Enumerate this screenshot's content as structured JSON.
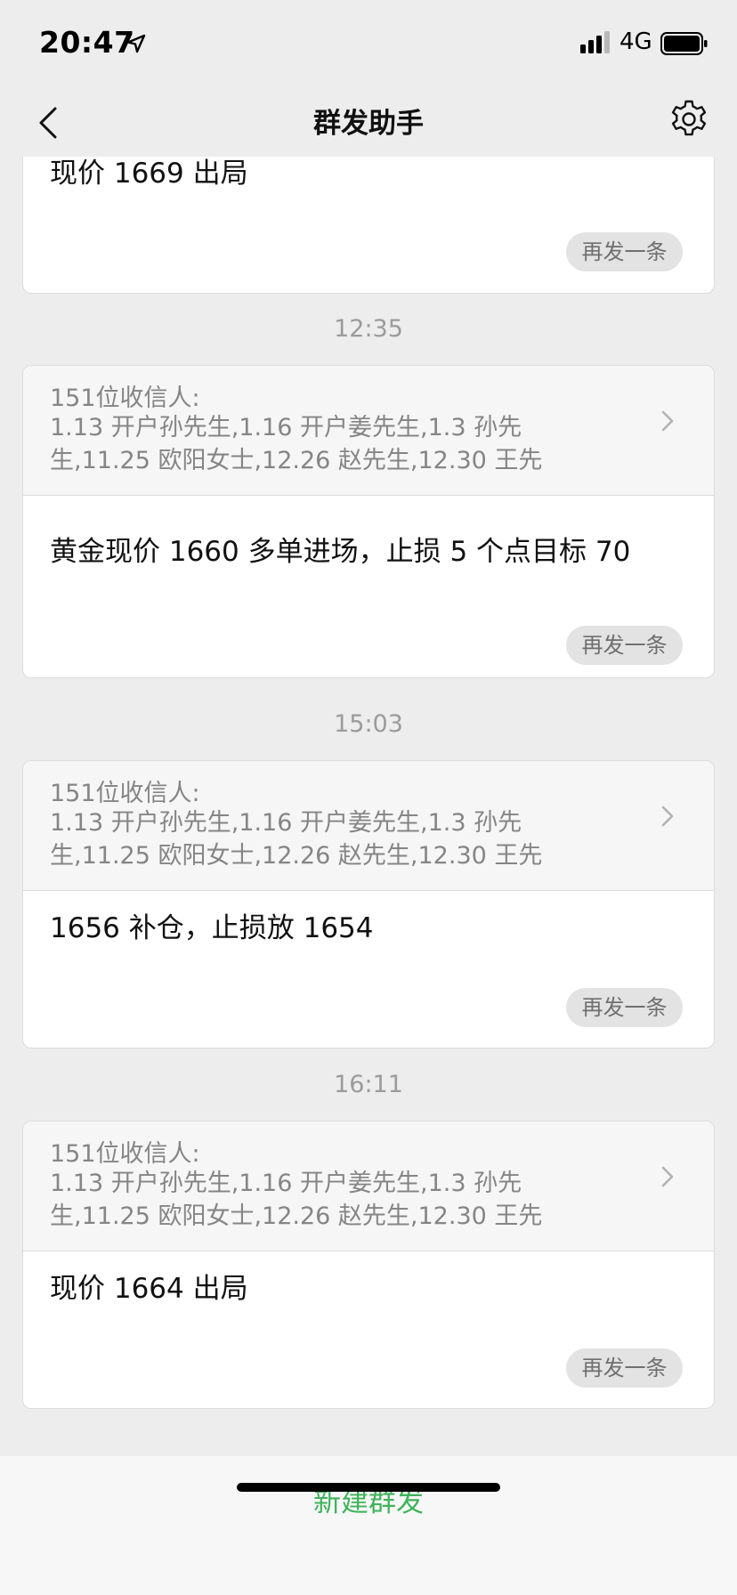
{
  "status_bar": {
    "time": "20:47",
    "network": "4G"
  },
  "nav": {
    "title": "群发助手"
  },
  "messages": [
    {
      "text": "现价 1669 出局",
      "resend_label": "再发一条"
    },
    {
      "time": "12:35",
      "recipients_count": "151位收信人:",
      "recipients_line1": "1.13 开户孙先生,1.16 开户姜先生,1.3 孙先",
      "recipients_line2": "生,11.25 欧阳女士,12.26 赵先生,12.30 王先",
      "text": "黄金现价 1660 多单进场，止损 5 个点目标 70",
      "resend_label": "再发一条"
    },
    {
      "time": "15:03",
      "recipients_count": "151位收信人:",
      "recipients_line1": "1.13 开户孙先生,1.16 开户姜先生,1.3 孙先",
      "recipients_line2": "生,11.25 欧阳女士,12.26 赵先生,12.30 王先",
      "text": "1656 补仓，止损放 1654",
      "resend_label": "再发一条"
    },
    {
      "time": "16:11",
      "recipients_count": "151位收信人:",
      "recipients_line1": "1.13 开户孙先生,1.16 开户姜先生,1.3 孙先",
      "recipients_line2": "生,11.25 欧阳女士,12.26 赵先生,12.30 王先",
      "text": "现价 1664 出局",
      "resend_label": "再发一条"
    }
  ],
  "footer": {
    "new_broadcast_label": "新建群发"
  },
  "colors": {
    "accent_green": "#3fb35a",
    "background": "#ededed"
  }
}
